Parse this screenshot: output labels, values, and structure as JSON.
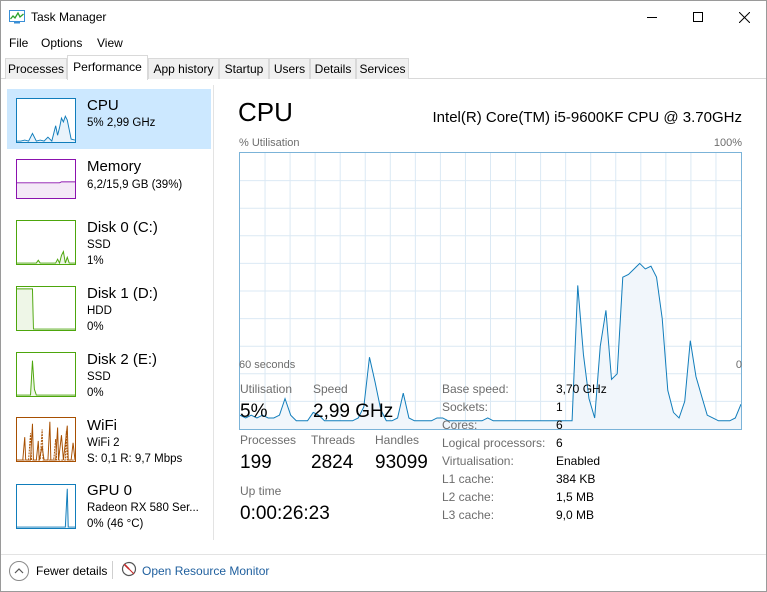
{
  "window": {
    "title": "Task Manager",
    "icon": "task-manager-icon"
  },
  "menu": {
    "items": [
      "File",
      "Options",
      "View"
    ]
  },
  "tabs": [
    "Processes",
    "Performance",
    "App history",
    "Startup",
    "Users",
    "Details",
    "Services"
  ],
  "active_tab": "Performance",
  "sidebar": {
    "items": [
      {
        "title": "CPU",
        "lines": [
          "5%  2,99 GHz"
        ],
        "color": "#117dbb",
        "selected": true
      },
      {
        "title": "Memory",
        "lines": [
          "6,2/15,9 GB (39%)"
        ],
        "color": "#8b12ae",
        "selected": false
      },
      {
        "title": "Disk 0 (C:)",
        "lines": [
          "SSD",
          "1%"
        ],
        "color": "#4da60c",
        "selected": false
      },
      {
        "title": "Disk 1 (D:)",
        "lines": [
          "HDD",
          "0%"
        ],
        "color": "#4da60c",
        "selected": false
      },
      {
        "title": "Disk 2 (E:)",
        "lines": [
          "SSD",
          "0%"
        ],
        "color": "#4da60c",
        "selected": false
      },
      {
        "title": "WiFi",
        "lines": [
          "WiFi 2",
          "S: 0,1  R: 9,7 Mbps"
        ],
        "color": "#a74f01",
        "selected": false
      },
      {
        "title": "GPU 0",
        "lines": [
          "Radeon RX 580 Ser...",
          "0% (46 °C)"
        ],
        "color": "#117dbb",
        "selected": false
      }
    ]
  },
  "main": {
    "title": "CPU",
    "model": "Intel(R) Core(TM) i5-9600KF CPU @ 3.70GHz",
    "graph": {
      "top_left": "% Utilisation",
      "top_right": "100%",
      "bottom_left": "60 seconds",
      "bottom_right": "0"
    },
    "stats": {
      "utilisation_label": "Utilisation",
      "utilisation_value": "5%",
      "speed_label": "Speed",
      "speed_value": "2,99 GHz",
      "processes_label": "Processes",
      "processes_value": "199",
      "threads_label": "Threads",
      "threads_value": "2824",
      "handles_label": "Handles",
      "handles_value": "93099",
      "uptime_label": "Up time",
      "uptime_value": "0:00:26:23"
    },
    "specs": [
      {
        "label": "Base speed:",
        "value": "3,70 GHz"
      },
      {
        "label": "Sockets:",
        "value": "1"
      },
      {
        "label": "Cores:",
        "value": "6"
      },
      {
        "label": "Logical processors:",
        "value": "6"
      },
      {
        "label": "Virtualisation:",
        "value": "Enabled"
      },
      {
        "label": "L1 cache:",
        "value": "384 KB"
      },
      {
        "label": "L2 cache:",
        "value": "1,5 MB"
      },
      {
        "label": "L3 cache:",
        "value": "9,0 MB"
      }
    ]
  },
  "footer": {
    "fewer_details": "Fewer details",
    "open_resource_monitor": "Open Resource Monitor"
  },
  "chart_data": {
    "type": "area",
    "xlabel": "",
    "ylabel": "% Utilisation",
    "x_range_label": [
      "60 seconds",
      "0"
    ],
    "ylim": [
      0,
      100
    ],
    "grid": true,
    "values": [
      5,
      4,
      5,
      4,
      5,
      4,
      4,
      5,
      11,
      5,
      3,
      3,
      3,
      6,
      5,
      3,
      3,
      3,
      3,
      3,
      3,
      4,
      8,
      26,
      17,
      7,
      3,
      3,
      4,
      13,
      4,
      3,
      3,
      3,
      3,
      4,
      4,
      3,
      3,
      3,
      3,
      3,
      3,
      3,
      4,
      3,
      3,
      3,
      3,
      3,
      3,
      3,
      3,
      3,
      3,
      3,
      3,
      3,
      3,
      3,
      52,
      27,
      11,
      4,
      30,
      43,
      18,
      20,
      55,
      56,
      58,
      60,
      58,
      59,
      55,
      40,
      14,
      6,
      4,
      10,
      32,
      19,
      12,
      5,
      4,
      3,
      3,
      3,
      4,
      9
    ]
  }
}
